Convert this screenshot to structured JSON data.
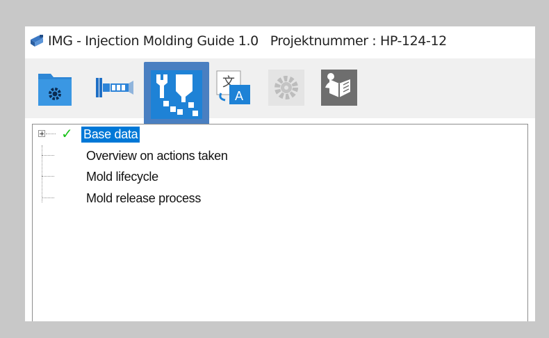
{
  "window": {
    "title": "IMG - Injection Molding Guide 1.0   Projektnummer : HP-124-12",
    "app_icon": "img-app-icon"
  },
  "toolbar": {
    "buttons": [
      {
        "id": "project",
        "icon": "folder-gear-icon"
      },
      {
        "id": "machine",
        "icon": "injection-unit-icon"
      },
      {
        "id": "tools",
        "icon": "tool-process-icon",
        "active": true
      },
      {
        "id": "language",
        "icon": "translate-icon"
      },
      {
        "id": "settings",
        "icon": "gear-icon",
        "disabled": true
      },
      {
        "id": "help",
        "icon": "manual-icon"
      }
    ]
  },
  "tree": {
    "items": [
      {
        "label": "Base data",
        "selected": true,
        "checked": true,
        "expandable": true
      },
      {
        "label": "Overview on actions taken"
      },
      {
        "label": "Mold lifecycle"
      },
      {
        "label": "Mold release process"
      }
    ]
  },
  "colors": {
    "selection": "#0078d7",
    "active_button": "#4a7fc1",
    "check": "#19c219"
  }
}
